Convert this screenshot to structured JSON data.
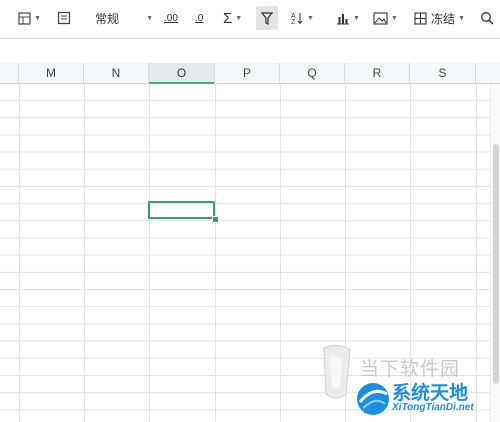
{
  "toolbar": {
    "format_label": "常规",
    "inc_decimal": ".00",
    "dec_decimal": ".0",
    "freeze_label": "冻结"
  },
  "columns": [
    "M",
    "N",
    "O",
    "P",
    "Q",
    "R",
    "S"
  ],
  "selected_column": "O",
  "watermark": {
    "line1": "当下软件园",
    "line2": "系统天地",
    "url": "XiTongTianDi.net"
  },
  "colors": {
    "accent": "#3c9d74",
    "watermark_blue": "#1c8fe0"
  }
}
